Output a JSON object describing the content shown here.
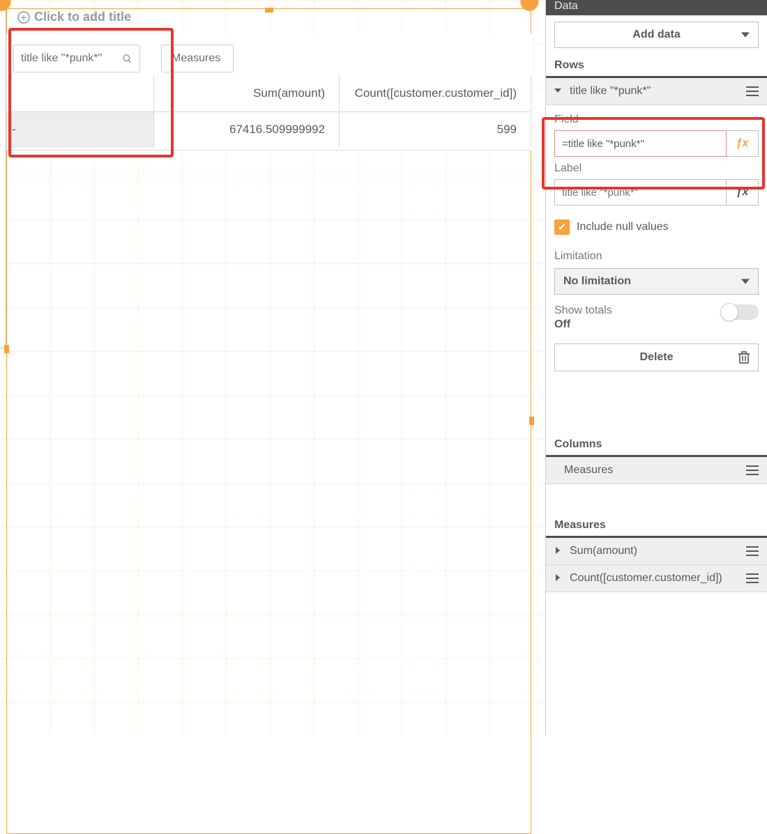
{
  "canvas": {
    "title_placeholder": "Click to add title",
    "dim_pill": "title like \"*punk*\"",
    "meas_pill": "Measures",
    "headers": [
      "Sum(amount)",
      "Count([customer.customer_id])"
    ],
    "row_label": "-",
    "values": [
      "67416.509999992",
      "599"
    ]
  },
  "panel": {
    "header": "Data",
    "add_data": "Add data",
    "sections": {
      "rows": "Rows",
      "columns": "Columns",
      "measures": "Measures"
    },
    "row_item": "title like \"*punk*\"",
    "field_label": "Field",
    "field_value": "=title like \"*punk*\"",
    "label_label": "Label",
    "label_placeholder": "title like \"*punk*\"",
    "include_null": "Include null values",
    "limitation_label": "Limitation",
    "limitation_value": "No limitation",
    "show_totals": "Show totals",
    "show_totals_state": "Off",
    "delete": "Delete",
    "col_item": "Measures",
    "measures": [
      "Sum(amount)",
      "Count([customer.customer_id])"
    ]
  }
}
